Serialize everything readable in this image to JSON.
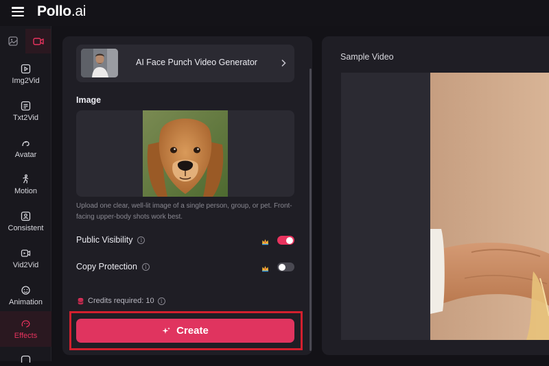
{
  "app": {
    "logo_main": "Pollo",
    "logo_suffix": ".ai"
  },
  "sidebar": {
    "items": [
      {
        "label": "Img2Vid",
        "icon": "image-to-video-icon"
      },
      {
        "label": "Txt2Vid",
        "icon": "text-to-video-icon"
      },
      {
        "label": "Avatar",
        "icon": "avatar-icon"
      },
      {
        "label": "Motion",
        "icon": "motion-icon"
      },
      {
        "label": "Consistent",
        "icon": "consistent-icon"
      },
      {
        "label": "Vid2Vid",
        "icon": "video-to-video-icon"
      },
      {
        "label": "Animation",
        "icon": "animation-icon"
      },
      {
        "label": "Effects",
        "icon": "effects-icon",
        "active": true
      }
    ]
  },
  "form": {
    "effect_title": "AI Face Punch Video Generator",
    "image_label": "Image",
    "upload_hint": "Upload one clear, well-lit image of a single person, group, or pet. Front-facing upper-body shots work best.",
    "public_visibility_label": "Public Visibility",
    "public_visibility_on": true,
    "copy_protection_label": "Copy Protection",
    "copy_protection_on": false,
    "credits_label": "Credits required: 10",
    "create_label": "Create"
  },
  "preview": {
    "title": "Sample Video"
  },
  "colors": {
    "accent": "#e0345f",
    "highlight_outline": "#d3202e",
    "panel": "#1f1e25",
    "background": "#131217"
  }
}
